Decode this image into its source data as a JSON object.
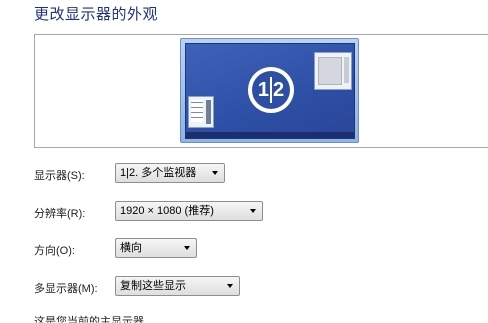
{
  "page": {
    "title": "更改显示器的外观"
  },
  "preview": {
    "badge_left": "1",
    "badge_right": "2"
  },
  "settings": {
    "display": {
      "label": "显示器(S):",
      "value": "1|2. 多个监视器"
    },
    "resolution": {
      "label": "分辨率(R):",
      "value": "1920 × 1080 (推荐)"
    },
    "orientation": {
      "label": "方向(O):",
      "value": "横向"
    },
    "multiple_displays": {
      "label": "多显示器(M):",
      "value": "复制这些显示"
    }
  },
  "footer": {
    "partial_text": "这是您当前的主显示器"
  },
  "colors": {
    "title": "#1e3287",
    "monitor_background": "#2e4fa6"
  }
}
